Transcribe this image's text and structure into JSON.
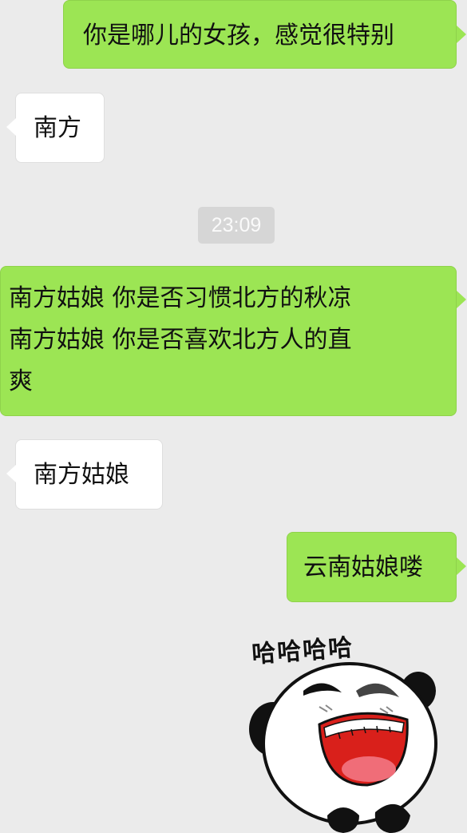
{
  "messages": [
    {
      "side": "out",
      "text": "你是哪儿的女孩，感觉很特别"
    },
    {
      "side": "in",
      "text": "南方"
    },
    {
      "side": "out",
      "lines": [
        "南方姑娘 你是否习惯北方的秋凉",
        "南方姑娘 你是否喜欢北方人的直",
        "爽"
      ]
    },
    {
      "side": "in",
      "text": "南方姑娘"
    },
    {
      "side": "out",
      "text": "云南姑娘喽"
    }
  ],
  "timestamp": "23:09",
  "sticker": {
    "caption": "哈哈哈哈",
    "icon": "laughing-panda-sticker"
  },
  "colors": {
    "background": "#ebebeb",
    "outgoing": "#9ce554",
    "incoming": "#ffffff",
    "timestamp_bg": "#d6d6d6"
  }
}
